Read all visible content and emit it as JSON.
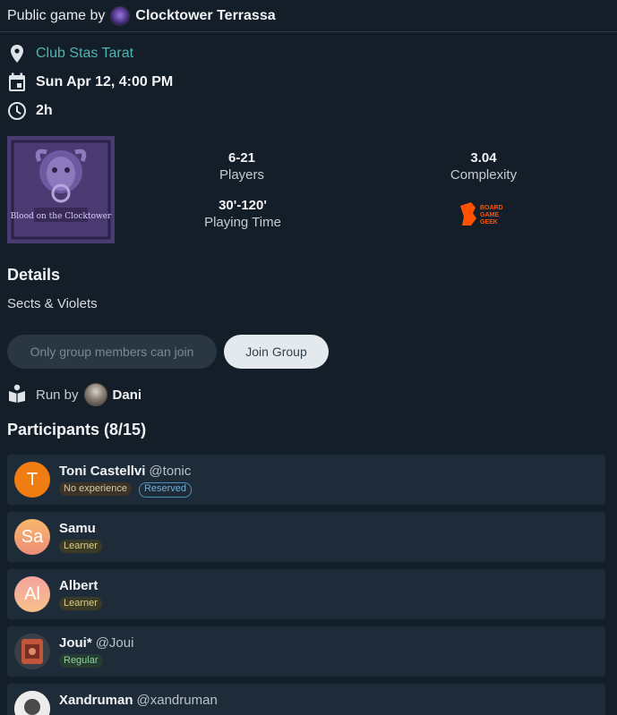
{
  "header": {
    "prefix": "Public game by",
    "organizer": "Clocktower Terrassa"
  },
  "event": {
    "location": "Club Stas Tarat",
    "date": "Sun Apr 12, 4:00 PM",
    "duration": "2h"
  },
  "game": {
    "box_title": "Blood on the Clocktower",
    "players_value": "6-21",
    "players_label": "Players",
    "time_value": "30'-120'",
    "time_label": "Playing Time",
    "complexity_value": "3.04",
    "complexity_label": "Complexity",
    "bgg_logo_text": [
      "BOARD",
      "GAME",
      "GEEK"
    ]
  },
  "details": {
    "title": "Details",
    "text": "Sects & Violets"
  },
  "actions": {
    "disabled_label": "Only group members can join",
    "join_label": "Join Group"
  },
  "runby": {
    "label": "Run by",
    "host": "Dani"
  },
  "participants": {
    "title": "Participants (8/15)",
    "list": [
      {
        "name": "Toni Castellvi",
        "handle": "@tonic",
        "initials": "T",
        "avatar_color": "#f07d12",
        "level": "No experience",
        "reserved": "Reserved"
      },
      {
        "name": "Samu",
        "handle": "",
        "initials": "Sa",
        "avatar_color": "#f2a36b",
        "level": "Learner"
      },
      {
        "name": "Albert",
        "handle": "",
        "initials": "Al",
        "avatar_color": "#f18d8d",
        "level": "Learner"
      },
      {
        "name": "Joui*",
        "handle": "@Joui",
        "initials": "",
        "avatar_color": "#7a4c3a",
        "level": "Regular"
      },
      {
        "name": "Xandruman",
        "handle": "@xandruman",
        "initials": "",
        "avatar_color": "#d8d8d8",
        "level": ""
      }
    ]
  },
  "colors": {
    "background": "#141e29",
    "card": "#1e2c39",
    "accent_teal": "#4fb3b0",
    "bgg_orange": "#ff5100"
  },
  "icons": {
    "location": "location-pin-icon",
    "date": "calendar-icon",
    "duration": "clock-icon",
    "runby": "book-reader-icon"
  }
}
